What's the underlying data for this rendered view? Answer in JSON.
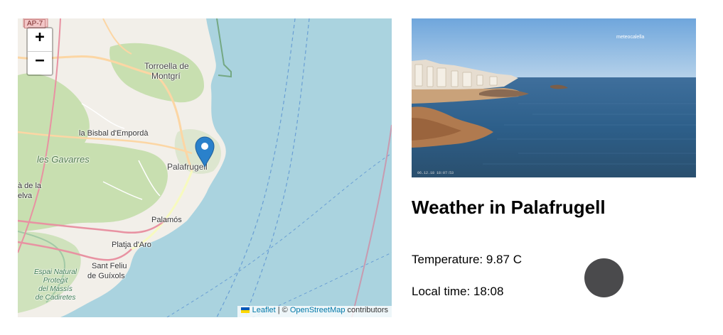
{
  "map": {
    "zoom_in_label": "+",
    "zoom_out_label": "−",
    "road_shield": "AP-7",
    "places": {
      "torroella_line1": "Torroella de",
      "torroella_line2": "Montgrí",
      "la_bisbal": "la Bisbal d'Empordà",
      "les_gavarres": "les Gavarres",
      "palafrugell": "Palafrugell",
      "cut_left_line1": "à de la",
      "cut_left_line2": "elva",
      "palamos": "Palamós",
      "platja_daro": "Platja d'Aro",
      "sant_feliu_line1": "Sant Feliu",
      "sant_feliu_line2": "de Guíxols",
      "espai_line1": "Espai Natural",
      "espai_line2": "Protegit",
      "espai_line3": "del Massís",
      "espai_line4": "de Cadiretes"
    },
    "marker_icon": "map-marker-icon",
    "attribution": {
      "leaflet": "Leaflet",
      "separator": " | © ",
      "osm": "OpenStreetMap",
      "suffix": " contributors"
    }
  },
  "photo": {
    "watermark": "meteocalella",
    "timestamp": "06.12.18 18:07:53"
  },
  "weather": {
    "title": "Weather in Palafrugell",
    "temperature": "Temperature: 9.87 C",
    "local_time": "Local time: 18:08"
  },
  "colors": {
    "sea": "#aad3df",
    "land": "#f2efe9",
    "forest": "#c8dfb0",
    "marker": "#2a81cb",
    "link": "#0078a8",
    "weather_icon": "#4a4a4c"
  }
}
